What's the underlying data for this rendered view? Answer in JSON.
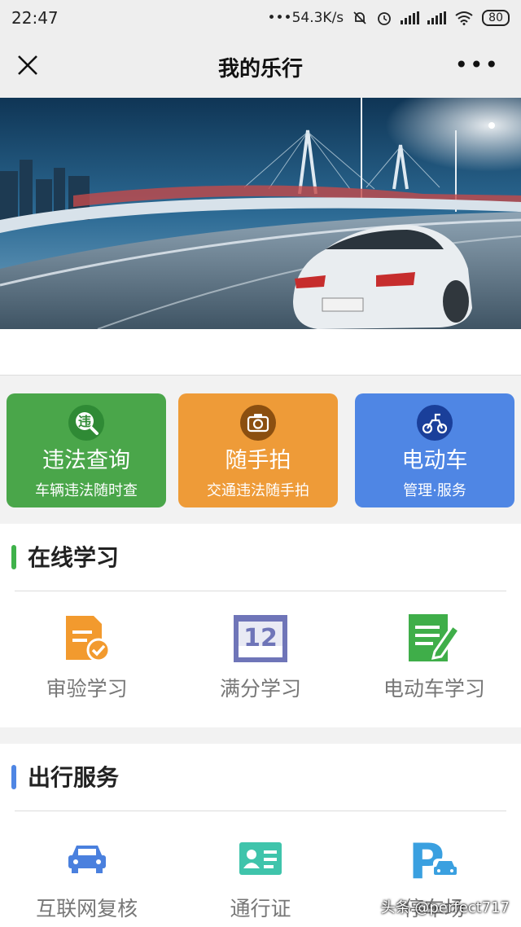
{
  "status": {
    "time": "22:47",
    "speed": "•••54.3K/s",
    "battery": "80"
  },
  "nav": {
    "title": "我的乐行",
    "more": "•••"
  },
  "cards": [
    {
      "name": "违法查询",
      "sub": "车辆违法随时查",
      "icon": "violation-icon",
      "color": "#4aa64a"
    },
    {
      "name": "随手拍",
      "sub": "交通违法随手拍",
      "icon": "camera-icon",
      "color": "#ee9b38"
    },
    {
      "name": "电动车",
      "sub": "管理·服务",
      "icon": "scooter-icon",
      "color": "#4f86e4"
    }
  ],
  "learning": {
    "title": "在线学习",
    "items": [
      {
        "label": "审验学习",
        "icon": "document-check-icon"
      },
      {
        "label": "满分学习",
        "icon": "calendar-12-icon",
        "icon_text": "12"
      },
      {
        "label": "电动车学习",
        "icon": "edit-note-icon"
      }
    ]
  },
  "travel": {
    "title": "出行服务",
    "items": [
      {
        "label": "互联网复核",
        "icon": "car-icon"
      },
      {
        "label": "通行证",
        "icon": "id-card-icon"
      },
      {
        "label": "停车场",
        "icon": "parking-icon",
        "icon_text": "P"
      }
    ]
  },
  "watermark": "头条 @perfect717"
}
